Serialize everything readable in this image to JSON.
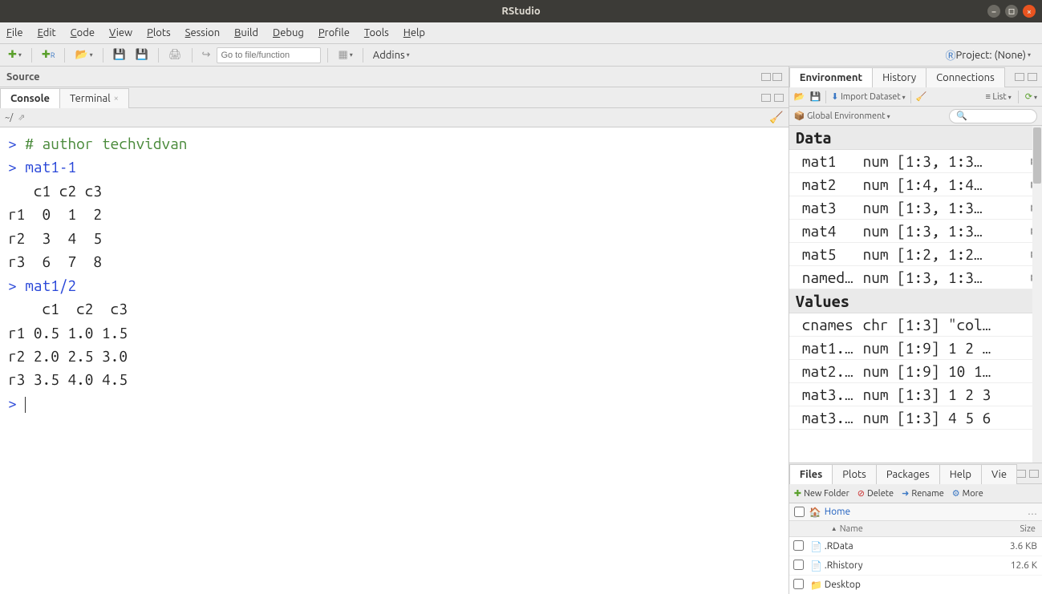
{
  "window": {
    "title": "RStudio"
  },
  "menu": [
    "File",
    "Edit",
    "Code",
    "View",
    "Plots",
    "Session",
    "Build",
    "Debug",
    "Profile",
    "Tools",
    "Help"
  ],
  "toolbar": {
    "goto_placeholder": "Go to file/function",
    "addins": "Addins",
    "project_label": "Project: (None)"
  },
  "source_pane": {
    "title": "Source"
  },
  "console_tabs": [
    "Console",
    "Terminal"
  ],
  "console_path": "~/",
  "console": {
    "lines": [
      {
        "p": ">",
        "t": "comment",
        "s": " # author techvidvan"
      },
      {
        "p": ">",
        "t": "input",
        "s": " mat1-1"
      },
      {
        "p": "",
        "t": "output",
        "s": "   c1 c2 c3"
      },
      {
        "p": "",
        "t": "output",
        "s": "r1  0  1  2"
      },
      {
        "p": "",
        "t": "output",
        "s": "r2  3  4  5"
      },
      {
        "p": "",
        "t": "output",
        "s": "r3  6  7  8"
      },
      {
        "p": ">",
        "t": "input",
        "s": " mat1/2"
      },
      {
        "p": "",
        "t": "output",
        "s": "    c1  c2  c3"
      },
      {
        "p": "",
        "t": "output",
        "s": "r1 0.5 1.0 1.5"
      },
      {
        "p": "",
        "t": "output",
        "s": "r2 2.0 2.5 3.0"
      },
      {
        "p": "",
        "t": "output",
        "s": "r3 3.5 4.0 4.5"
      },
      {
        "p": ">",
        "t": "input",
        "s": " "
      }
    ]
  },
  "env_tabs": [
    "Environment",
    "History",
    "Connections"
  ],
  "env_toolbar": {
    "import": "Import Dataset",
    "list": "List",
    "scope": "Global Environment"
  },
  "env_sections": {
    "data_label": "Data",
    "values_label": "Values",
    "data": [
      {
        "name": "mat1",
        "val": "num [1:3, 1:3…"
      },
      {
        "name": "mat2",
        "val": "num [1:4, 1:4…"
      },
      {
        "name": "mat3",
        "val": "num [1:3, 1:3…"
      },
      {
        "name": "mat4",
        "val": "num [1:3, 1:3…"
      },
      {
        "name": "mat5",
        "val": "num [1:2, 1:2…"
      },
      {
        "name": "named…",
        "val": "num [1:3, 1:3…"
      }
    ],
    "values": [
      {
        "name": "cnames",
        "val": "chr [1:3] \"col…"
      },
      {
        "name": "mat1.…",
        "val": "num [1:9] 1 2 …"
      },
      {
        "name": "mat2.…",
        "val": "num [1:9] 10 1…"
      },
      {
        "name": "mat3.…",
        "val": "num [1:3] 1 2 3"
      },
      {
        "name": "mat3.…",
        "val": "num [1:3] 4 5 6"
      }
    ]
  },
  "files_tabs": [
    "Files",
    "Plots",
    "Packages",
    "Help",
    "Vie"
  ],
  "files_toolbar": {
    "new_folder": "New Folder",
    "delete": "Delete",
    "rename": "Rename",
    "more": "More"
  },
  "files_crumb": {
    "home": "Home"
  },
  "files_header": {
    "name": "Name",
    "size": "Size"
  },
  "files": [
    {
      "name": ".RData",
      "size": "3.6 KB",
      "icon": "rdata"
    },
    {
      "name": ".Rhistory",
      "size": "12.6 K",
      "icon": "file"
    },
    {
      "name": "Desktop",
      "size": "",
      "icon": "folder"
    }
  ]
}
